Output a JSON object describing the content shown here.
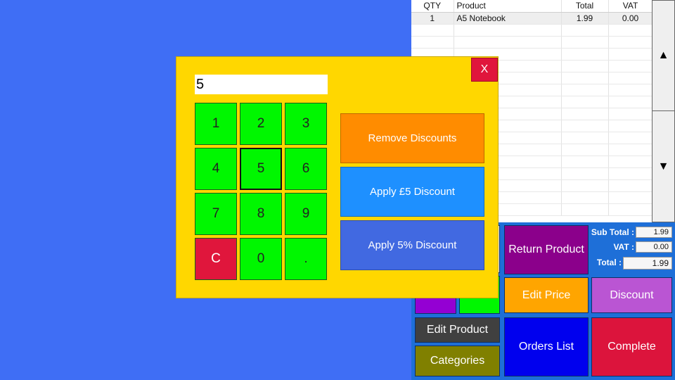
{
  "order": {
    "columns": {
      "qty": "QTY",
      "product": "Product",
      "total": "Total",
      "vat": "VAT"
    },
    "rows": [
      {
        "qty": "1",
        "product": "A5 Notebook",
        "total": "1.99",
        "vat": "0.00"
      }
    ]
  },
  "scroll": {
    "up": "▲",
    "down": "▼"
  },
  "totals": {
    "subtotal_label": "Sub Total :",
    "subtotal": "1.99",
    "vat_label": "VAT :",
    "vat": "0.00",
    "total_label": "Total :",
    "total": "1.99"
  },
  "actions": {
    "return_product": "Return Product",
    "edit_price": "Edit Price",
    "discount": "Discount",
    "edit_product": "Edit Product",
    "orders_list": "Orders List",
    "complete": "Complete",
    "categories": "Categories"
  },
  "dialog": {
    "close": "X",
    "input_value": "5",
    "keys": [
      "1",
      "2",
      "3",
      "4",
      "5",
      "6",
      "7",
      "8",
      "9",
      "C",
      "0",
      "."
    ],
    "remove_discounts": "Remove Discounts",
    "apply_fixed": "Apply £5 Discount",
    "apply_percent": "Apply 5% Discount"
  },
  "colors": {
    "background": "#3f6ef5",
    "dialog_bg": "#ffd700",
    "key_green": "#00f700",
    "clear_red": "#e0163c",
    "remove_orange": "#ff8c00",
    "apply_fixed_blue": "#1e90ff",
    "apply_percent_blue": "#4169e1",
    "return_purple": "#8b008b",
    "edit_price_orange": "#ffa500",
    "discount_orchid": "#ba55d3",
    "edit_product_gray": "#404040",
    "orders_blue": "#0000ee",
    "complete_crimson": "#dc143c",
    "categories_olive": "#808000"
  }
}
